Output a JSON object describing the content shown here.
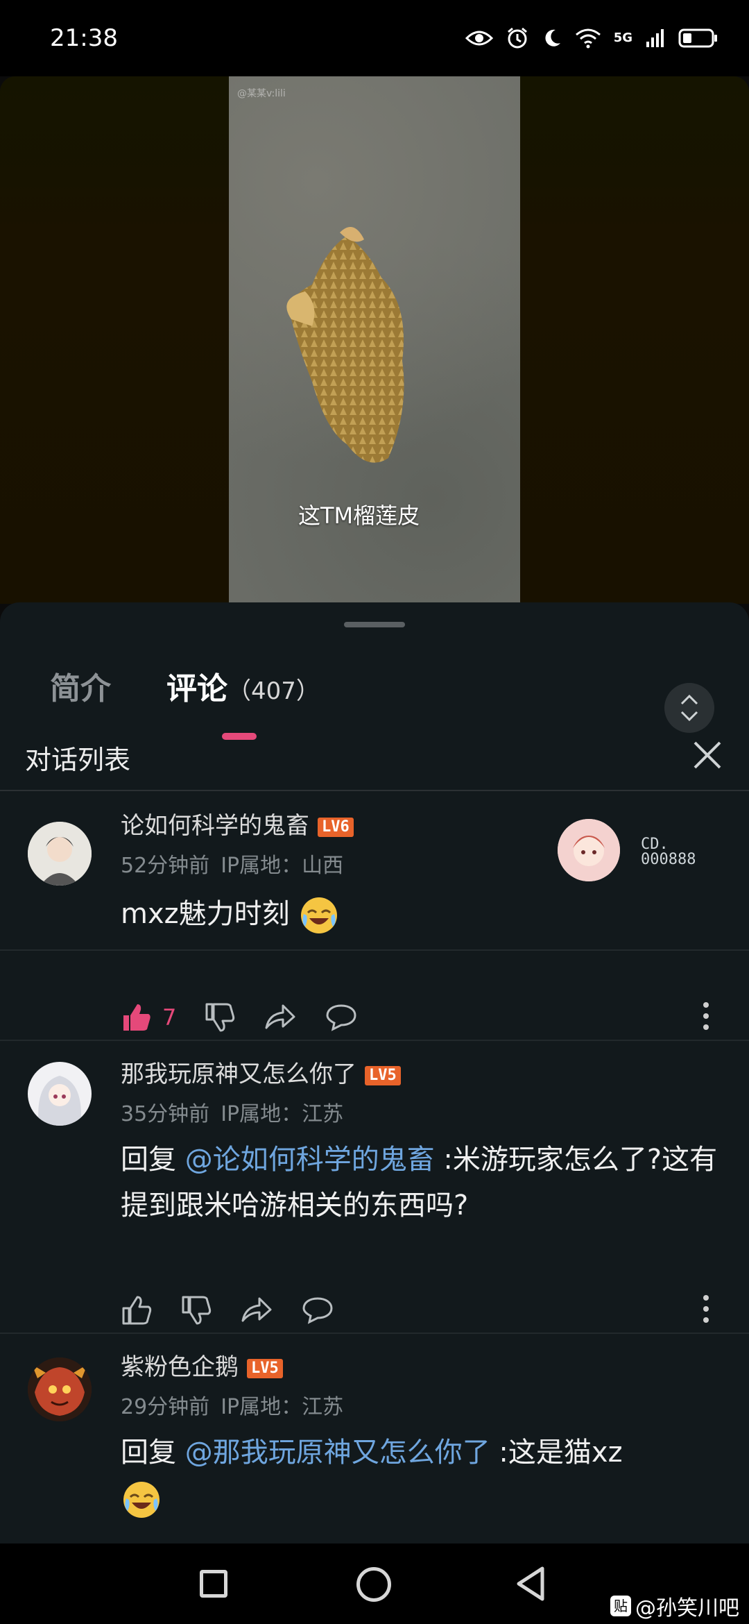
{
  "status_bar": {
    "time": "21:38",
    "network": "5G"
  },
  "video": {
    "watermark": "@某某v:lili",
    "subtitle": "这TM榴莲皮"
  },
  "tabs": {
    "intro": "简介",
    "comments": "评论",
    "comments_count": "（407）"
  },
  "dialog": {
    "title": "对话列表"
  },
  "fan_badge": {
    "line1": "CD.",
    "line2": "000888"
  },
  "comments": [
    {
      "username": "论如何科学的鬼畜",
      "level": "LV6",
      "time": "52分钟前",
      "ip": "IP属地：山西",
      "text": "mxz魅力时刻",
      "like_count": "7",
      "liked": true
    },
    {
      "username": "那我玩原神又怎么你了",
      "level": "LV5",
      "time": "35分钟前",
      "ip": "IP属地：江苏",
      "reply_prefix": "回复 ",
      "mention": "@论如何科学的鬼畜",
      "text": " :米游玩家怎么了?这有提到跟米哈游相关的东西吗?"
    },
    {
      "username": "紫粉色企鹅",
      "level": "LV5",
      "time": "29分钟前",
      "ip": "IP属地：江苏",
      "reply_prefix": "回复 ",
      "mention": "@那我玩原神又怎么你了",
      "text": " :这是猫xz"
    }
  ],
  "watermark": {
    "logo": "贴",
    "text": "@孙笑川吧"
  },
  "colors": {
    "accent": "#e5497a",
    "mention": "#6fa6df",
    "level": "#e8632a",
    "sheet_bg": "#12191c"
  }
}
